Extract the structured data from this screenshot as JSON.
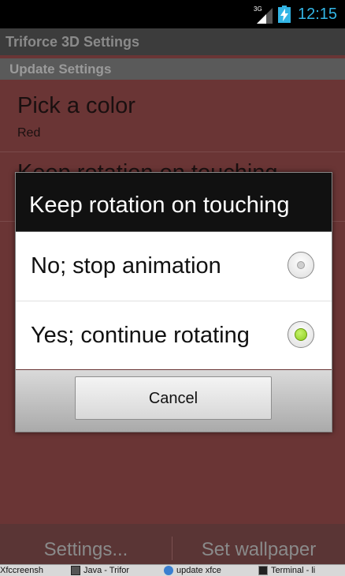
{
  "status_bar": {
    "network": "3G",
    "time": "12:15",
    "time_color": "#33b5e5",
    "icons": [
      "signal-icon",
      "battery-charging-icon"
    ]
  },
  "app": {
    "title": "Triforce 3D Settings",
    "section_header": "Update Settings"
  },
  "preferences": [
    {
      "title": "Pick a color",
      "summary": "Red"
    },
    {
      "title": "Keep rotation on touching"
    }
  ],
  "dialog": {
    "title": "Keep rotation on touching",
    "options": [
      {
        "label": "No; stop animation",
        "selected": false
      },
      {
        "label": "Yes; continue rotating",
        "selected": true
      }
    ],
    "cancel_label": "Cancel"
  },
  "bottom_actions": {
    "settings_label": "Settings...",
    "wallpaper_label": "Set wallpaper"
  },
  "taskbar": [
    {
      "label": "Xfccreensh",
      "icon": "app-icon"
    },
    {
      "label": "Java - Trifor",
      "icon": "java-icon"
    },
    {
      "label": "update xfce",
      "icon": "browser-icon"
    },
    {
      "label": "Terminal - li",
      "icon": "terminal-icon"
    }
  ],
  "colors": {
    "background": "#6a3535",
    "accent": "#33b5e5",
    "radio_selected": "#8ccc1e"
  }
}
